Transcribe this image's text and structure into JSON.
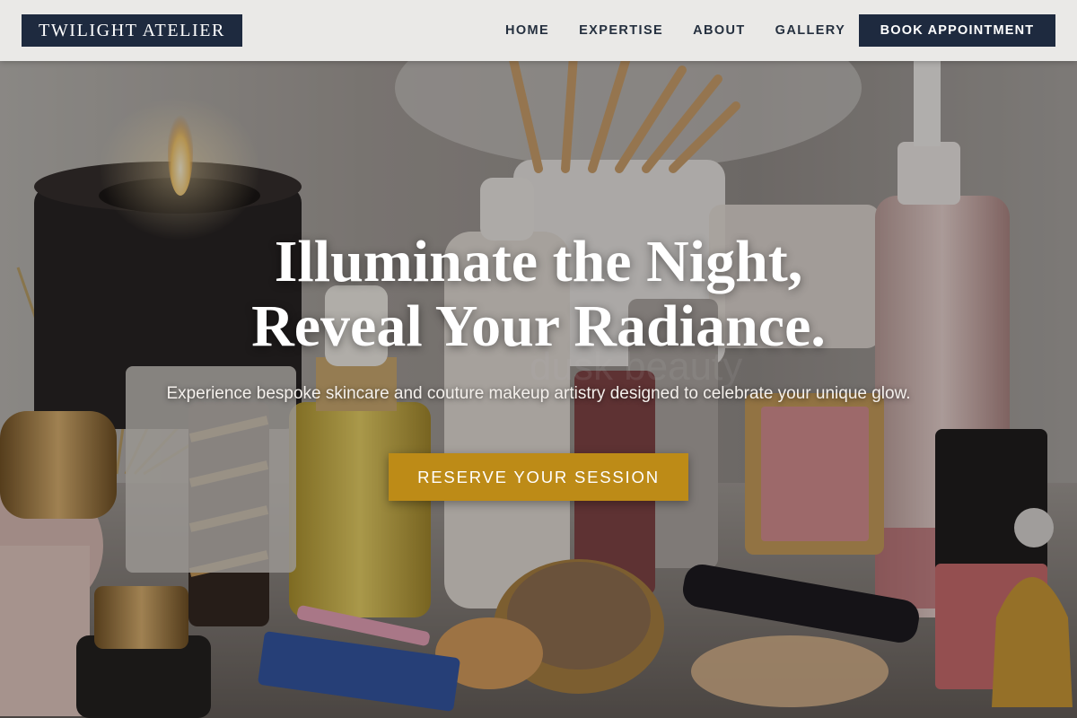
{
  "header": {
    "logo_text": "TWILIGHT ATELIER",
    "nav": [
      {
        "label": "HOME"
      },
      {
        "label": "EXPERTISE"
      },
      {
        "label": "ABOUT"
      },
      {
        "label": "GALLERY"
      }
    ],
    "cta_label": "BOOK APPOINTMENT"
  },
  "hero": {
    "headline_line1": "Illuminate the Night,",
    "headline_line2": "Reveal Your Radiance.",
    "subheadline": "Experience bespoke skincare and couture makeup artistry designed to celebrate your unique glow.",
    "cta_label": "RESERVE YOUR SESSION",
    "background_image": "vanity-table-with-cosmetics-and-candle"
  },
  "colors": {
    "navy": "#1e2a3f",
    "gold": "#bd8b17",
    "header_bg": "#f6f5f3",
    "nav_text": "#25303f"
  }
}
